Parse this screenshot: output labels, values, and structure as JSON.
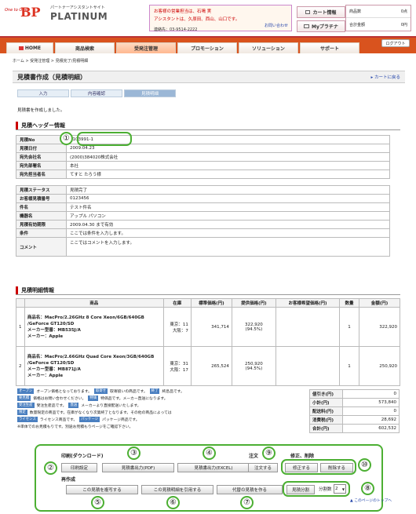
{
  "header": {
    "logo_small": "One to One",
    "logo_bp": "BP",
    "logo_sub": "パートナーアシスタントサイト",
    "logo_platinum": "PLATINUM",
    "contact_line1": "お客様の営業担当は、石鳴 実",
    "contact_line2": "アシスタントは、久原田、西山、山口です。",
    "contact_tel": "連絡先：03-9514-2222",
    "inquiry_link": "お問い合わせ",
    "cart_btn": "カート情報",
    "myplat_btn": "Myプラチナ",
    "items_label": "商品数",
    "items_value": "0点",
    "total_label": "合計金額",
    "total_value": "0円"
  },
  "nav": {
    "home": "HOME",
    "tabs": [
      "商品検索",
      "受発注管理",
      "プロモーション",
      "ソリューション",
      "サポート"
    ],
    "logout": "ログアウト"
  },
  "breadcrumb": "ホーム > 受発注管理 > 見積完了/見積明細",
  "page_title": "見積書作成（見積明細）",
  "back_to_cart": "カートに戻る",
  "steps": [
    "入力",
    "内容確認",
    "見積明細"
  ],
  "done_message": "見積書を作成しました。",
  "header_section": {
    "title": "見積ヘッダー情報",
    "rows_a": [
      {
        "k": "見積No",
        "v": "2103991-1"
      },
      {
        "k": "見積日付",
        "v": "2009.04.23"
      },
      {
        "k": "宛先会社名",
        "v": "(2000)384020株式会社"
      },
      {
        "k": "宛先部署名",
        "v": "本社"
      },
      {
        "k": "宛先担当者名",
        "v": "てすと たろう様"
      }
    ],
    "rows_b": [
      {
        "k": "見積ステータス",
        "v": "見積完了"
      },
      {
        "k": "お客様見積番号",
        "v": "0123456"
      },
      {
        "k": "件名",
        "v": "テスト件名"
      },
      {
        "k": "機器名",
        "v": "アップル パソコン"
      },
      {
        "k": "見積有効期限",
        "v": "2009.04.30 まで有効"
      },
      {
        "k": "条件",
        "v": "ここでは条件を入力します。"
      }
    ],
    "comment_label": "コメント",
    "comment_value": "ここではコメントを入力します。"
  },
  "detail_section": {
    "title": "見積明細情報",
    "columns": [
      "",
      "商品",
      "在庫",
      "標準価格(円)",
      "提供価格(円)",
      "お客様希望価格(円)",
      "数量",
      "金額(円)"
    ],
    "rows": [
      {
        "no": "1",
        "name": "商品名：MacPro/2.26GHz 8 Core Xeon/6GB/640GB",
        "name2": "/GeForce GT120/SD",
        "maker_no": "メーカー型番：MB535J/A",
        "maker": "メーカー：Apple",
        "stock": "東京：11\n大阪：7",
        "std": "341,714",
        "offer": "322,920",
        "offer_pct": "(94.5%)",
        "wish": "",
        "qty": "1",
        "amount": "322,920"
      },
      {
        "no": "2",
        "name": "商品名：MacPro/2.66GHz Quad Core Xeon/3GB/640GB",
        "name2": "/GeForce GT120/SD",
        "maker_no": "メーカー型番：MB871J/A",
        "maker": "メーカー：Apple",
        "stock": "東京：31\n大阪：17",
        "std": "265,524",
        "offer": "250,920",
        "offer_pct": "(94.5%)",
        "wish": "",
        "qty": "1",
        "amount": "250,920"
      }
    ]
  },
  "legend": [
    {
      "chip": "オープン",
      "text": "オープン価格となっております。",
      "chip2": "取寄せ",
      "text2": "取寄扱いの商品です。",
      "chip3": "終了",
      "text3": "終息品です。"
    },
    {
      "chip": "要見積",
      "text": "価格はお問い合わせください。",
      "chip2": "特価",
      "text2": "特価品です。メーカー直送になります。"
    },
    {
      "chip": "受注生産",
      "text": "受注生産品です。",
      "chip2": "直送",
      "text2": "メーカーより直接配送いたします。"
    },
    {
      "chip": "限定",
      "text": "数量限定の商品です。在庫がなくなり次第終了となります。その他の商品によっては",
      "chip2": "",
      "text2": ""
    },
    {
      "chip": "ライセンス",
      "text": "ライセンス商品です。",
      "chip2": "パッケージ",
      "text2": "パッケージ商品です。"
    },
    {
      "chip": "",
      "text": "※単体でのお見積もりです。別途お見積もりページをご確認下さい。",
      "chip2": "",
      "text2": ""
    }
  ],
  "totals": [
    {
      "k": "値引き(円)",
      "v": "0"
    },
    {
      "k": "小計(円)",
      "v": "573,840"
    },
    {
      "k": "配送料(円)",
      "v": "0"
    },
    {
      "k": "消費税(円)",
      "v": "28,692"
    },
    {
      "k": "合計(円)",
      "v": "602,532"
    }
  ],
  "actions": {
    "print_label": "印刷(ダウンロード)",
    "print_settings": "印刷設定",
    "pdf": "見積書出力(PDF)",
    "excel": "見積書出力(EXCEL)",
    "order_label": "注文",
    "order_btn": "注文する",
    "edit_label": "修正、削除",
    "edit_btn": "修正する",
    "delete_btn": "削除する",
    "recreate_label": "再作成",
    "copy_btn": "この見積を複写する",
    "reuse_btn": "この見積明細を引用する",
    "alt_btn": "代替の見積を作る",
    "split_btn": "見積分割",
    "split_count_label": "分割数",
    "split_count_value": "2",
    "top_link": "▲ このページのトップへ"
  },
  "callouts": [
    "①",
    "②",
    "③",
    "④",
    "⑤",
    "⑥",
    "⑦",
    "⑧",
    "⑨",
    "⑩"
  ]
}
